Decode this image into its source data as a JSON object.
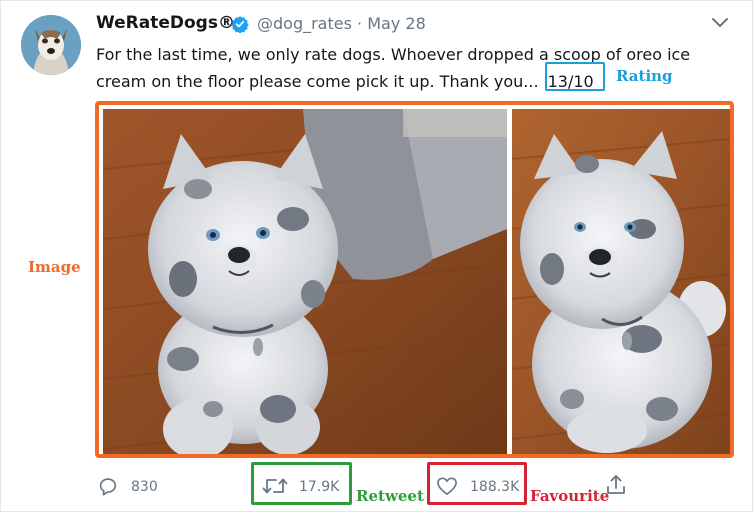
{
  "tweet": {
    "display_name": "WeRateDogs®",
    "handle": "@dog_rates",
    "separator": "·",
    "date": "May 28",
    "text": "For the last time, we only rate dogs. Whoever dropped a scoop of oreo ice cream on the floor please come pick it up. Thank you...",
    "rating": "13/10"
  },
  "annotations": {
    "rating": "Rating",
    "image": "Image",
    "retweet": "Retweet",
    "favourite": "Favourite"
  },
  "actions": {
    "replies": "830",
    "retweets": "17.9K",
    "likes": "188.3K"
  },
  "colors": {
    "rating_box": "#1a9fd9",
    "image_box": "#f06a28",
    "retweet_box": "#2d9c3c",
    "favourite_box": "#d22434",
    "verified": "#1da1f2",
    "muted": "#657786"
  },
  "icons": [
    "verified-icon",
    "chevron-down-icon",
    "reply-icon",
    "retweet-icon",
    "heart-icon",
    "share-icon"
  ]
}
